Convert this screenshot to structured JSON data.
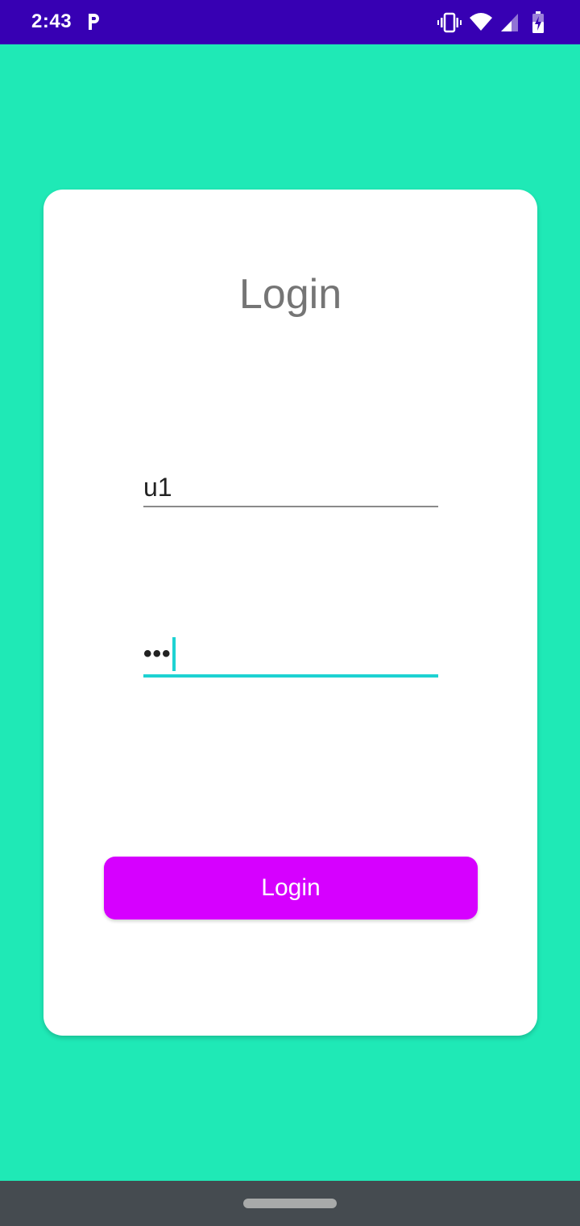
{
  "status_bar": {
    "time": "2:43",
    "notification_icon": "parking-p-icon",
    "icons": [
      "vibrate-icon",
      "wifi-icon",
      "signal-icon",
      "battery-charging-icon"
    ]
  },
  "login_form": {
    "title": "Login",
    "username_value": "u1",
    "password_masked": "•••",
    "submit_label": "Login"
  },
  "colors": {
    "status_bar": "#3700b3",
    "background": "#1fe9b6",
    "card": "#ffffff",
    "button": "#d600ff",
    "focus_accent": "#1ed2d2",
    "nav_bar": "#454b50"
  }
}
